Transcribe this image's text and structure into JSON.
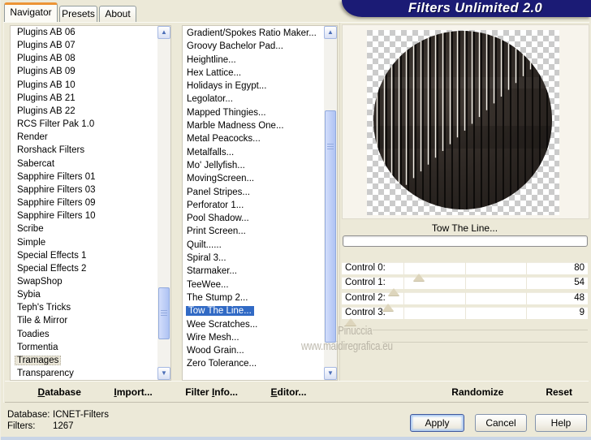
{
  "window_title": "Filters Unlimited 2.0",
  "tabs": [
    {
      "label": "Navigator",
      "active": true
    },
    {
      "label": "Presets",
      "active": false
    },
    {
      "label": "About",
      "active": false
    }
  ],
  "category_list": {
    "items": [
      "Plugins AB 06",
      "Plugins AB 07",
      "Plugins AB 08",
      "Plugins AB 09",
      "Plugins AB 10",
      "Plugins AB 21",
      "Plugins AB 22",
      "RCS Filter Pak 1.0",
      "Render",
      "Rorshack Filters",
      "Sabercat",
      "Sapphire Filters 01",
      "Sapphire Filters 03",
      "Sapphire Filters 09",
      "Sapphire Filters 10",
      "Scribe",
      "Simple",
      "Special Effects 1",
      "Special Effects 2",
      "SwapShop",
      "Sybia",
      "Teph's Tricks",
      "Tile & Mirror",
      "Toadies",
      "Tormentia",
      "Tramages",
      "Transparency"
    ],
    "selected": "Tramages"
  },
  "filter_list": {
    "items": [
      "Gradient/Spokes Ratio Maker...",
      "Groovy Bachelor Pad...",
      "Heightline...",
      "Hex Lattice...",
      "Holidays in Egypt...",
      "Legolator...",
      "Mapped Thingies...",
      "Marble Madness One...",
      "Metal Peacocks...",
      "Metalfalls...",
      "Mo' Jellyfish...",
      "MovingScreen...",
      "Panel Stripes...",
      "Perforator 1...",
      "Pool Shadow...",
      "Print Screen...",
      "Quilt......",
      "Spiral 3...",
      "Starmaker...",
      "TeeWee...",
      "The Stump 2...",
      "Tow The Line...",
      "Wee Scratches...",
      "Wire Mesh...",
      "Wood Grain...",
      "Zero Tolerance..."
    ],
    "selected": "Tow The Line..."
  },
  "preview": {
    "caption": "Tow The Line...",
    "progress_percent": 0
  },
  "controls": {
    "range_max": 255,
    "sliders": [
      {
        "label": "Control 0:",
        "value": 80
      },
      {
        "label": "Control 1:",
        "value": 54
      },
      {
        "label": "Control 2:",
        "value": 48
      },
      {
        "label": "Control 3:",
        "value": 9
      }
    ]
  },
  "toolbar": {
    "left_items": [
      {
        "label": "Database",
        "underline_index": 0
      },
      {
        "label": "Import...",
        "underline_index": 0
      },
      {
        "label": "Filter Info...",
        "underline_index": 7
      },
      {
        "label": "Editor...",
        "underline_index": 0
      }
    ],
    "right_items": [
      {
        "label": "Randomize",
        "underline_index": -1
      },
      {
        "label": "Reset",
        "underline_index": -1
      }
    ]
  },
  "status": {
    "database_label": "Database:",
    "database_value": "ICNET-Filters",
    "filters_label": "Filters:",
    "filters_value": "1267"
  },
  "buttons": {
    "apply": "Apply",
    "cancel": "Cancel",
    "help": "Help"
  },
  "watermark": {
    "line1": "Pinuccia",
    "line2": "www.maidiregrafica.eu"
  },
  "colors": {
    "dialog_bg": "#ece9d8",
    "banner_bg": "#1b1b75",
    "selection_blue": "#316ac5",
    "soft_selection": "#eae6d8",
    "tab_accent_orange": "#ec9435",
    "checker_gray": "#cbcbcb",
    "slider_triangle": "#ddd5bc"
  }
}
